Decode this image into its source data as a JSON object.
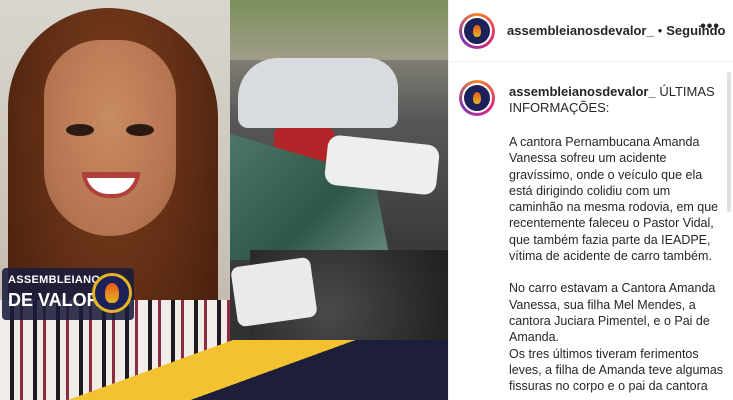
{
  "post": {
    "brand_line1": "ASSEMBLEIANOS",
    "brand_line2": "DE VALOR"
  },
  "header": {
    "username": "assembleianosdevalor_",
    "separator": "•",
    "follow_status": "Seguindo",
    "more_icon": "more-horizontal-icon"
  },
  "caption": {
    "username": "assembleianosdevalor_",
    "headline": "ÚLTIMAS INFORMAÇÕES:",
    "paragraphs": [
      "A cantora Pernambucana Amanda Vanessa sofreu um acidente gravíssimo, onde o veículo que ela está dirigindo colidiu com um caminhão na mesma rodovia, em que recentemente faleceu o Pastor Vidal, que também fazia parte da IEADPE, vítima de acidente de carro também.",
      "No carro estavam a Cantora Amanda Vanessa, sua filha Mel Mendes, a cantora Juciara Pimentel, e o Pai de Amanda.",
      "Os tres últimos tiveram ferimentos leves, a filha de Amanda teve algumas fissuras no corpo e o pai da cantora"
    ]
  },
  "colors": {
    "brand_navy": "#1d2159",
    "brand_gold": "#e6b422",
    "text": "#262626"
  }
}
